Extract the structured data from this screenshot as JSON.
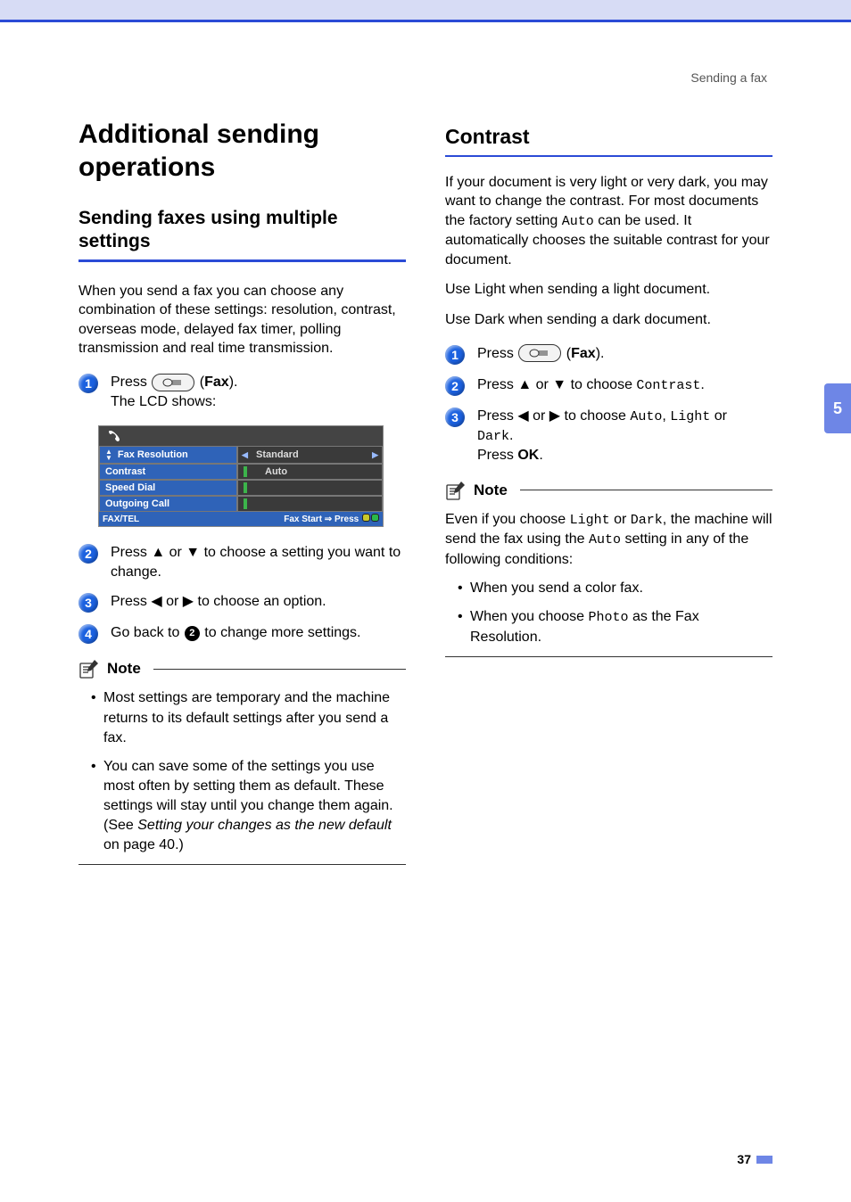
{
  "header": {
    "breadcrumb": "Sending a fax"
  },
  "sidetab": {
    "chapter": "5"
  },
  "page_number": "37",
  "left": {
    "h1_line1": "Additional sending",
    "h1_line2": "operations",
    "h2_line1": "Sending faxes using multiple",
    "h2_line2": "settings",
    "intro": "When you send a fax you can choose any combination of these settings: resolution, contrast, overseas mode, delayed fax timer, polling transmission and real time transmission.",
    "step1_pre": "Press ",
    "step1_post": " (",
    "step1_fax": "Fax",
    "step1_close": ").",
    "step1_line2": "The LCD shows:",
    "lcd": {
      "rows": [
        {
          "label": "Fax Resolution",
          "value": "Standard",
          "arrows": true,
          "leftIcon": true
        },
        {
          "label": "Contrast",
          "value": "Auto",
          "greenbar": true
        },
        {
          "label": "Speed Dial",
          "value": "",
          "greenbar": true
        },
        {
          "label": "Outgoing Call",
          "value": "",
          "greenbar": true
        }
      ],
      "footer_left": "FAX/TEL",
      "footer_right_pre": "Fax Start ⇒ Press "
    },
    "step2": "Press ▲ or ▼ to choose a setting you want to change.",
    "step3": "Press ◀ or ▶ to choose an option.",
    "step4_pre": "Go back to ",
    "step4_refnum": "2",
    "step4_post": " to change more settings.",
    "note_label": "Note",
    "note_items": [
      "Most settings are temporary and the machine returns to its default settings after you send a fax.",
      {
        "pre": "You can save some of the settings you use most often by setting them as default. These settings will stay until you change them again. (See ",
        "em": "Setting your changes as the new default",
        "post": " on page 40.)"
      }
    ]
  },
  "right": {
    "h2": "Contrast",
    "p1_pre": "If your document is very light or very dark, you may want to change the contrast. For most documents the factory setting ",
    "p1_mono": "Auto",
    "p1_post": " can be used. It automatically chooses the suitable contrast for your document.",
    "p2": "Use Light when sending a light document.",
    "p3": "Use Dark when sending a dark document.",
    "step1_pre": "Press ",
    "step1_post": " (",
    "step1_fax": "Fax",
    "step1_close": ").",
    "step2_pre": "Press ▲ or ▼ to choose ",
    "step2_mono": "Contrast",
    "step2_post": ".",
    "step3_pre": "Press ◀ or ▶ to choose ",
    "step3_mono1": "Auto",
    "step3_mid1": ", ",
    "step3_mono2": "Light",
    "step3_mid2": " or ",
    "step3_mono3": "Dark",
    "step3_post": ".",
    "step3_line2_pre": "Press ",
    "step3_line2_b": "OK",
    "step3_line2_post": ".",
    "note_label": "Note",
    "note_intro_pre": "Even if you choose ",
    "note_intro_m1": "Light",
    "note_intro_mid": " or ",
    "note_intro_m2": "Dark",
    "note_intro_post1": ", the machine will send the fax using the ",
    "note_intro_m3": "Auto",
    "note_intro_post2": " setting in any of the following conditions:",
    "note_items": [
      "When you send a color fax.",
      {
        "pre": "When you choose ",
        "mono": "Photo",
        "post": " as the Fax Resolution."
      }
    ]
  }
}
